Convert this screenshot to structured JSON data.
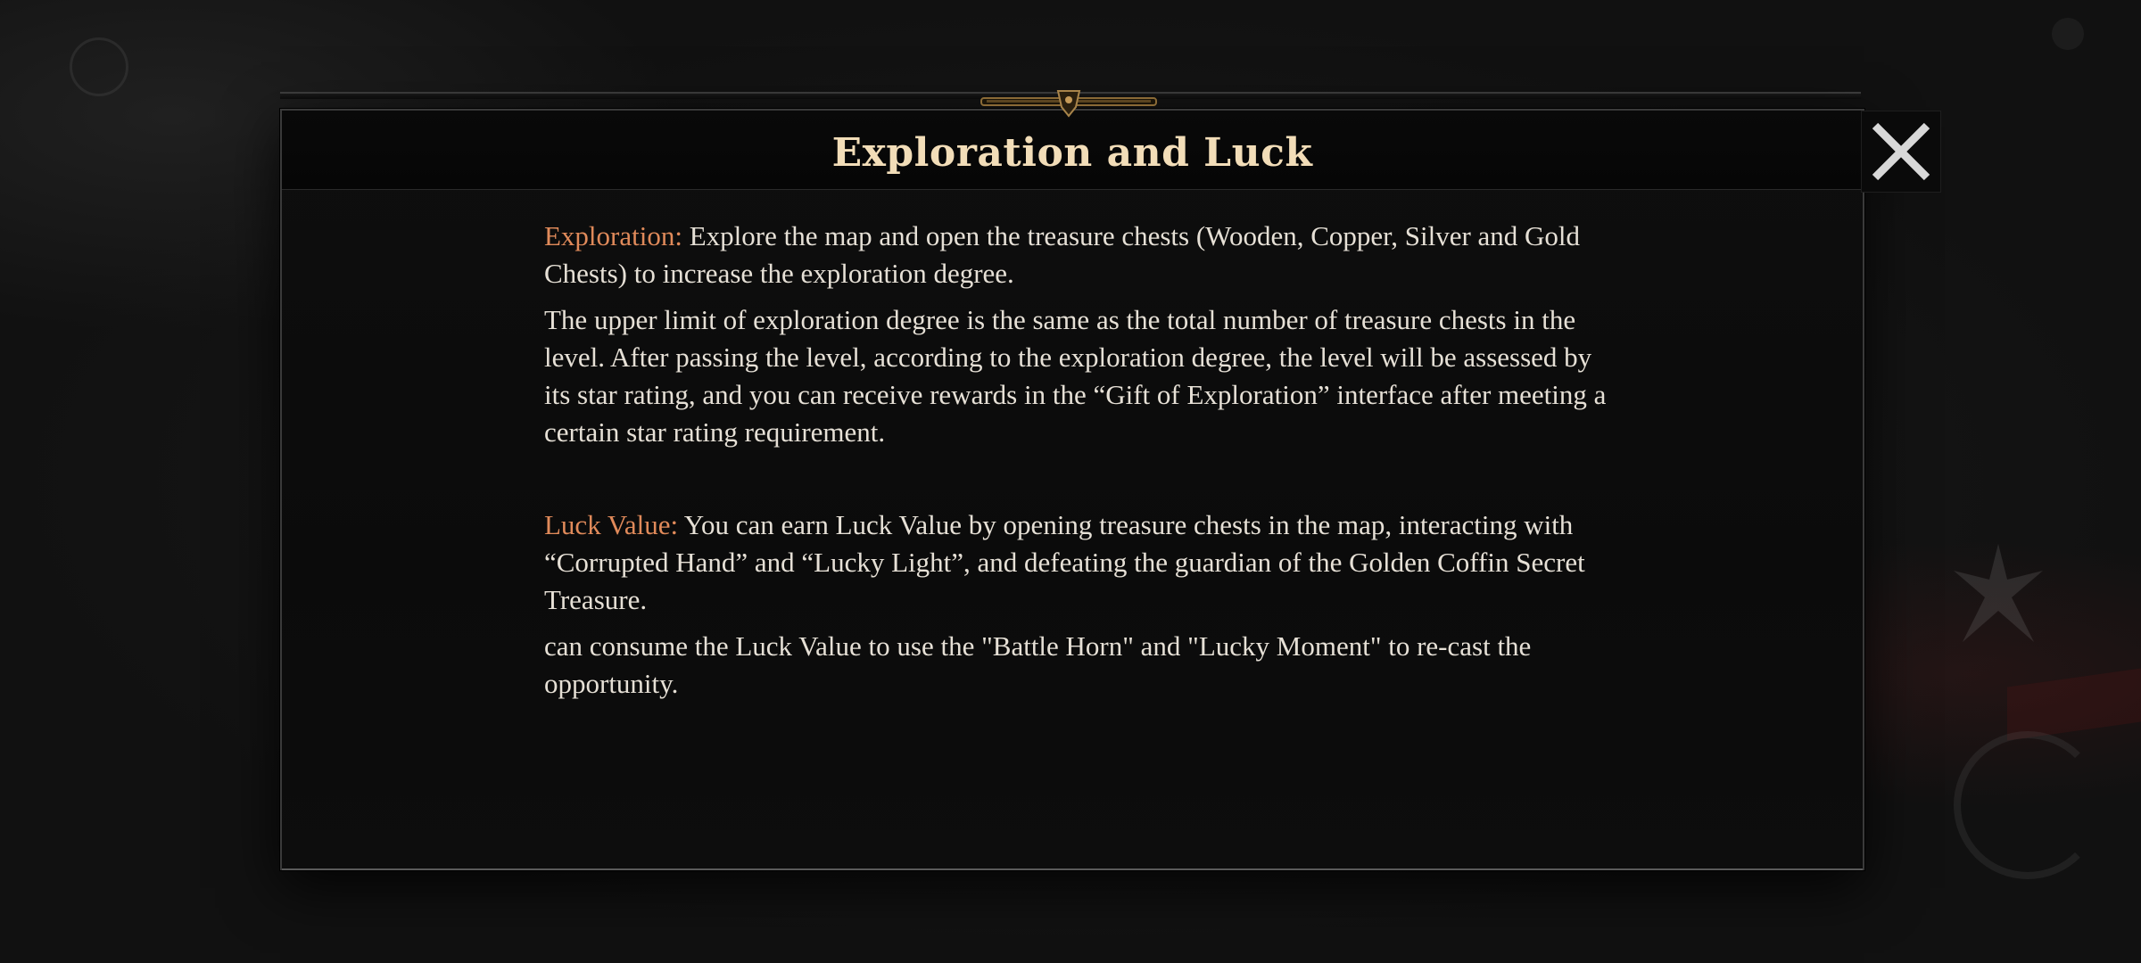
{
  "dialog": {
    "title": "Exploration and Luck",
    "close_icon": "close-icon",
    "sections": [
      {
        "label": "Exploration:",
        "text": " Explore the map and open the treasure chests (Wooden, Copper, Silver and Gold Chests) to increase the exploration degree."
      },
      {
        "text": " The upper limit of exploration degree is the same as the total number of treasure chests in the level. After passing the level, according to the exploration degree, the level will be assessed by its star rating, and you can receive rewards in the “Gift of Exploration” interface after meeting a certain star rating requirement."
      },
      {
        "label": "Luck Value:",
        "text": " You can earn Luck Value by opening treasure chests in the map, interacting with “Corrupted Hand” and “Lucky Light”, and defeating the guardian of the Golden Coffin Secret Treasure."
      },
      {
        "text": " can consume the Luck Value to use the \"Battle Horn\" and \"Lucky Moment\" to re-cast the opportunity."
      }
    ]
  },
  "colors": {
    "title": "#f2ddb8",
    "label_accent": "#e08a5a",
    "body_text": "#e6e0d6",
    "panel_bg": "#0b0b0b"
  }
}
